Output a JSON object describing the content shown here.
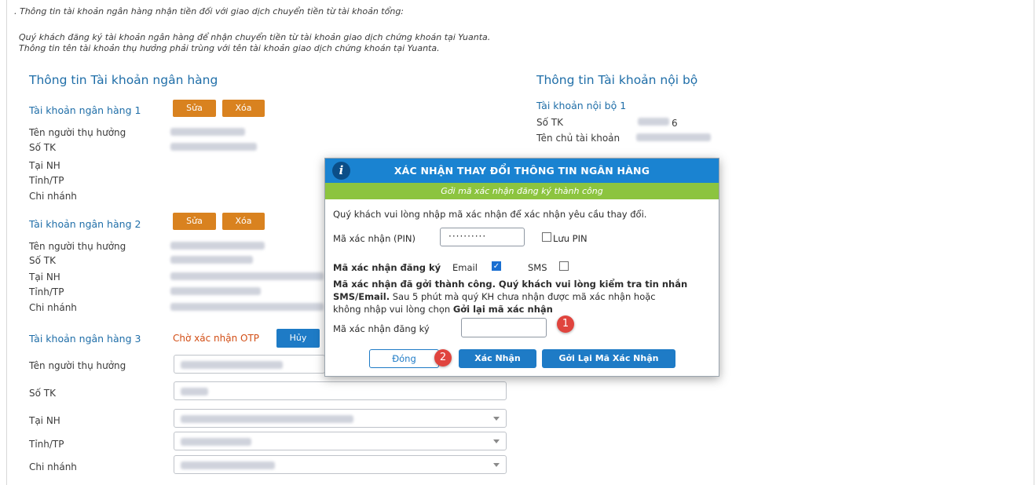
{
  "intro": {
    "line1": ". Thông tin tài khoản ngân hàng nhận tiền đối với giao dịch chuyển tiền từ tài khoản tổng:",
    "line2": "Quý khách đăng ký tài khoản ngân hàng để nhận chuyển tiền từ tài khoản giao dịch chứng khoán tại Yuanta.",
    "line3": "Thông tin tên tài khoản thụ hưởng phải trùng với tên tài khoản giao dịch chứng khoán tại Yuanta."
  },
  "bank_section": {
    "title": "Thông tin Tài khoản ngân hàng",
    "accounts": [
      {
        "title": "Tài khoản ngân hàng 1",
        "edit": "Sửa",
        "delete": "Xóa"
      },
      {
        "title": "Tài khoản ngân hàng 2",
        "edit": "Sửa",
        "delete": "Xóa"
      },
      {
        "title": "Tài khoản ngân hàng 3",
        "status": "Chờ xác nhận OTP",
        "cancel": "Hủy"
      }
    ],
    "labels": {
      "beneficiary": "Tên người thụ hưởng",
      "account_no": "Số TK",
      "bank": "Tại NH",
      "province": "Tỉnh/TP",
      "branch": "Chi nhánh"
    }
  },
  "internal_section": {
    "title": "Thông tin Tài khoản nội bộ",
    "account_title": "Tài khoản nội bộ 1",
    "account_no_label": "Số TK",
    "account_no_tail": "6",
    "owner_label": "Tên chủ tài khoản"
  },
  "dialog": {
    "title": "XÁC NHẬN THAY ĐỔI THÔNG TIN NGÂN HÀNG",
    "success_banner": "Gởi mã xác nhận đăng ký thành công",
    "instruction": "Quý khách vui lòng nhập mã xác nhận để xác nhận yêu cầu thay đổi.",
    "pin_label": "Mã xác nhận (PIN)",
    "pin_value": "··········",
    "save_pin_label": "Lưu PIN",
    "reg_code_method_label": "Mã xác nhận đăng ký",
    "email_label": "Email",
    "sms_label": "SMS",
    "notice_bold": "Mã xác nhận đã gởi thành công. Quý khách vui lòng kiểm tra tin nhắn",
    "notice_bold2": "SMS/Email.",
    "notice_rest": " Sau 5 phút mà quý KH chưa nhận được mã xác nhận hoặc",
    "notice_line3": "không nhập vui lòng chọn ",
    "notice_link": "Gởi lại mã xác nhận",
    "reg_code_label": "Mã xác nhận đăng ký",
    "close_button": "Đóng",
    "confirm_button": "Xác Nhận",
    "resend_button": "Gởi Lại Mã Xác Nhận"
  },
  "annotations": {
    "step1": "1",
    "step2": "2"
  },
  "colors": {
    "primary_blue": "#1e7bc6",
    "header_blue": "#1a83d1",
    "success_green": "#8cc43f",
    "orange": "#d9821f",
    "badge_red": "#e0443e"
  }
}
